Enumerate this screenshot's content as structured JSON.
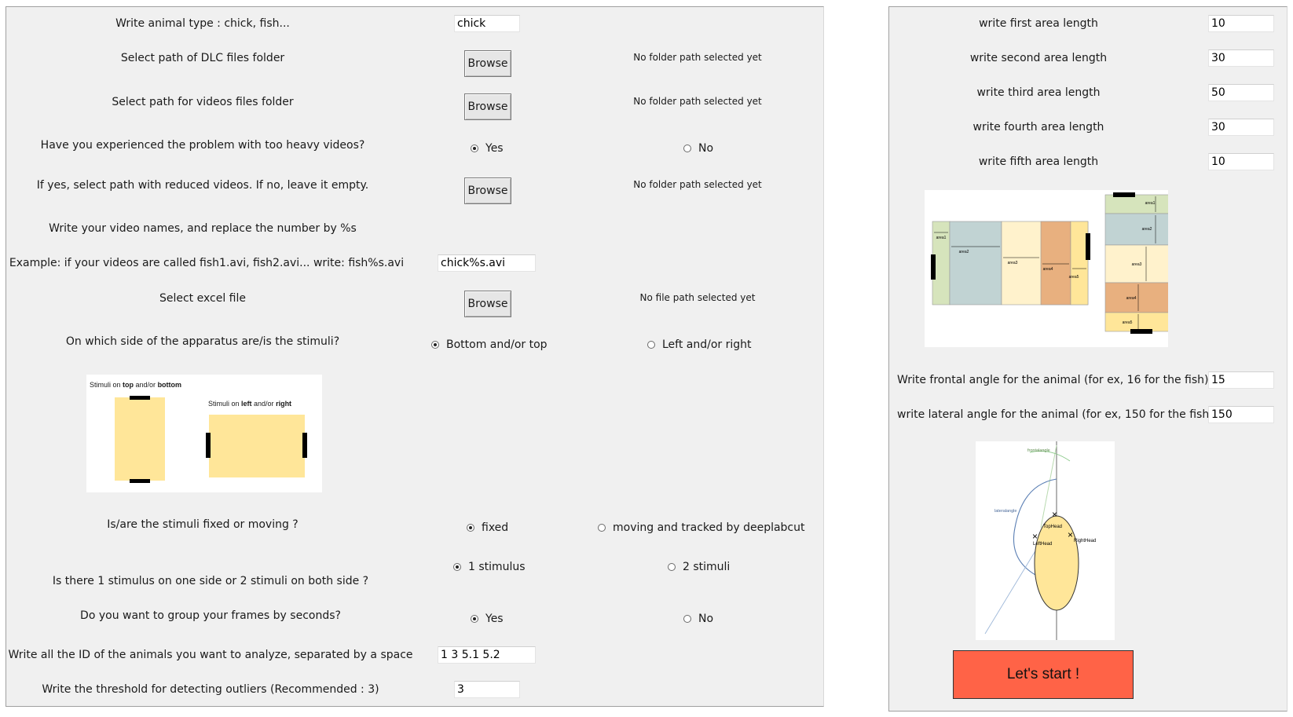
{
  "left": {
    "animal_type": {
      "label": "Write animal type : chick, fish...",
      "value": "chick"
    },
    "dlc_folder": {
      "label": "Select path of DLC files folder",
      "button": "Browse",
      "status": "No folder path selected yet"
    },
    "videos_folder": {
      "label": "Select path for videos files folder",
      "button": "Browse",
      "status": "No folder path selected yet"
    },
    "heavy_videos": {
      "label": "Have you experienced the problem with too heavy videos?",
      "opt_yes": "Yes",
      "opt_no": "No",
      "selected": "Yes"
    },
    "reduced_videos": {
      "label": "If yes, select path with reduced videos. If no, leave it empty.",
      "button": "Browse",
      "status": "No folder path selected yet"
    },
    "video_names": {
      "label": "Write your video names, and replace the number by %s",
      "example": "Example: if your videos are called fish1.avi, fish2.avi... write: fish%s.avi",
      "value": "chick%s.avi"
    },
    "excel_file": {
      "label": "Select excel file",
      "button": "Browse",
      "status": "No file path selected yet"
    },
    "stimuli_side": {
      "label": "On which side of the apparatus are/is the stimuli?",
      "opt_a": "Bottom and/or top",
      "opt_b": "Left and/or right",
      "selected": "Bottom and/or top"
    },
    "stimuli_image": {
      "caption_a_pre": "Stimuli on ",
      "caption_a_b1": "top",
      "caption_a_mid": " and/or ",
      "caption_a_b2": "bottom",
      "caption_b_pre": "Stimuli on ",
      "caption_b_b1": "left",
      "caption_b_mid": " and/or ",
      "caption_b_b2": "right"
    },
    "stimuli_fixed": {
      "label": "Is/are the stimuli fixed or moving ?",
      "opt_a": "fixed",
      "opt_b": "moving and tracked by deeplabcut",
      "selected": "fixed"
    },
    "stimulus_count": {
      "label": "Is there 1 stimulus on one side or 2 stimuli on both side ?",
      "opt_a": "1 stimulus",
      "opt_b": "2 stimuli",
      "selected": "1 stimulus"
    },
    "group_frames": {
      "label": "Do you want to group your frames by seconds?",
      "opt_yes": "Yes",
      "opt_no": "No",
      "selected": "Yes"
    },
    "animal_ids": {
      "label": "Write all the ID of the animals you want to analyze, separated by a space",
      "value": "1 3 5.1 5.2"
    },
    "threshold": {
      "label": "Write the threshold for detecting outliers (Recommended : 3)",
      "value": "3"
    }
  },
  "right": {
    "areas": [
      {
        "label": "write first area length",
        "value": "10"
      },
      {
        "label": "write second area length",
        "value": "30"
      },
      {
        "label": "write third area length",
        "value": "50"
      },
      {
        "label": "write fourth area length",
        "value": "30"
      },
      {
        "label": "write fifth area length",
        "value": "10"
      }
    ],
    "area_image": {
      "labels": [
        "area1",
        "area2",
        "area3",
        "area4",
        "area5"
      ]
    },
    "frontal_angle": {
      "label": "Write frontal angle for the animal (for ex, 16 for the fish).",
      "value": "15"
    },
    "lateral_angle": {
      "label": "write lateral angle for the animal (for ex, 150 for the fish)",
      "value": "150"
    },
    "angle_image": {
      "frontal": "frontalangle",
      "lateral": "lateralangle",
      "top": "TopHead",
      "left": "LeftHead",
      "right": "RightHead"
    },
    "start_button": "Let's start !"
  },
  "colors": {
    "panel_bg": "#f0f0f0",
    "start_button": "#ff6347",
    "area1": "#d6e4bc",
    "area2": "#c1d3d3",
    "area3": "#fff2cc",
    "area4": "#e8b07f",
    "area5": "#ffe699",
    "stimulus_box": "#ffe699"
  }
}
